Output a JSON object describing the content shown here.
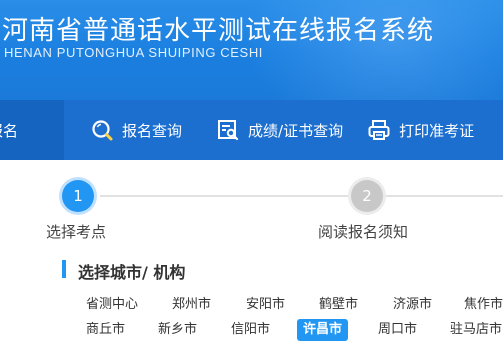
{
  "header": {
    "title_cn": "河南省普通话水平测试在线报名系统",
    "title_en": "HENAN PUTONGHUA SHUIPING CESHI"
  },
  "nav": {
    "items": [
      {
        "label": "报名",
        "icon": "none",
        "active": true
      },
      {
        "label": "报名查询",
        "icon": "search-icon",
        "active": false
      },
      {
        "label": "成绩/证书查询",
        "icon": "certificate-search-icon",
        "active": false
      },
      {
        "label": "打印准考证",
        "icon": "printer-icon",
        "active": false
      }
    ]
  },
  "steps": [
    {
      "number": "1",
      "label": "选择考点",
      "active": true
    },
    {
      "number": "2",
      "label": "阅读报名须知",
      "active": false
    }
  ],
  "section": {
    "title": "选择城市/ 机构"
  },
  "cities": {
    "row1": [
      "省测中心",
      "郑州市",
      "安阳市",
      "鹤壁市",
      "济源市",
      "焦作市"
    ],
    "row2": [
      "商丘市",
      "新乡市",
      "信阳市",
      "许昌市",
      "周口市",
      "驻马店市"
    ],
    "selected": "许昌市"
  },
  "colors": {
    "banner": "#1b7fe0",
    "nav": "#1d6fcf",
    "accent": "#2196f3"
  }
}
